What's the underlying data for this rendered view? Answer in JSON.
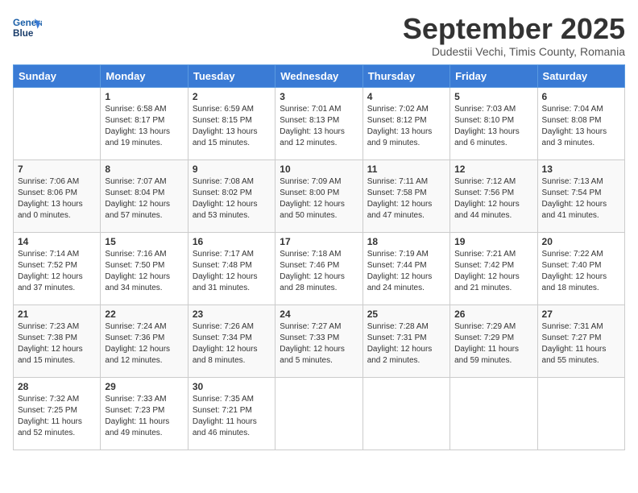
{
  "header": {
    "logo_line1": "General",
    "logo_line2": "Blue",
    "month_title": "September 2025",
    "subtitle": "Dudestii Vechi, Timis County, Romania"
  },
  "days_of_week": [
    "Sunday",
    "Monday",
    "Tuesday",
    "Wednesday",
    "Thursday",
    "Friday",
    "Saturday"
  ],
  "weeks": [
    [
      {
        "day": "",
        "content": ""
      },
      {
        "day": "1",
        "content": "Sunrise: 6:58 AM\nSunset: 8:17 PM\nDaylight: 13 hours\nand 19 minutes."
      },
      {
        "day": "2",
        "content": "Sunrise: 6:59 AM\nSunset: 8:15 PM\nDaylight: 13 hours\nand 15 minutes."
      },
      {
        "day": "3",
        "content": "Sunrise: 7:01 AM\nSunset: 8:13 PM\nDaylight: 13 hours\nand 12 minutes."
      },
      {
        "day": "4",
        "content": "Sunrise: 7:02 AM\nSunset: 8:12 PM\nDaylight: 13 hours\nand 9 minutes."
      },
      {
        "day": "5",
        "content": "Sunrise: 7:03 AM\nSunset: 8:10 PM\nDaylight: 13 hours\nand 6 minutes."
      },
      {
        "day": "6",
        "content": "Sunrise: 7:04 AM\nSunset: 8:08 PM\nDaylight: 13 hours\nand 3 minutes."
      }
    ],
    [
      {
        "day": "7",
        "content": "Sunrise: 7:06 AM\nSunset: 8:06 PM\nDaylight: 13 hours\nand 0 minutes."
      },
      {
        "day": "8",
        "content": "Sunrise: 7:07 AM\nSunset: 8:04 PM\nDaylight: 12 hours\nand 57 minutes."
      },
      {
        "day": "9",
        "content": "Sunrise: 7:08 AM\nSunset: 8:02 PM\nDaylight: 12 hours\nand 53 minutes."
      },
      {
        "day": "10",
        "content": "Sunrise: 7:09 AM\nSunset: 8:00 PM\nDaylight: 12 hours\nand 50 minutes."
      },
      {
        "day": "11",
        "content": "Sunrise: 7:11 AM\nSunset: 7:58 PM\nDaylight: 12 hours\nand 47 minutes."
      },
      {
        "day": "12",
        "content": "Sunrise: 7:12 AM\nSunset: 7:56 PM\nDaylight: 12 hours\nand 44 minutes."
      },
      {
        "day": "13",
        "content": "Sunrise: 7:13 AM\nSunset: 7:54 PM\nDaylight: 12 hours\nand 41 minutes."
      }
    ],
    [
      {
        "day": "14",
        "content": "Sunrise: 7:14 AM\nSunset: 7:52 PM\nDaylight: 12 hours\nand 37 minutes."
      },
      {
        "day": "15",
        "content": "Sunrise: 7:16 AM\nSunset: 7:50 PM\nDaylight: 12 hours\nand 34 minutes."
      },
      {
        "day": "16",
        "content": "Sunrise: 7:17 AM\nSunset: 7:48 PM\nDaylight: 12 hours\nand 31 minutes."
      },
      {
        "day": "17",
        "content": "Sunrise: 7:18 AM\nSunset: 7:46 PM\nDaylight: 12 hours\nand 28 minutes."
      },
      {
        "day": "18",
        "content": "Sunrise: 7:19 AM\nSunset: 7:44 PM\nDaylight: 12 hours\nand 24 minutes."
      },
      {
        "day": "19",
        "content": "Sunrise: 7:21 AM\nSunset: 7:42 PM\nDaylight: 12 hours\nand 21 minutes."
      },
      {
        "day": "20",
        "content": "Sunrise: 7:22 AM\nSunset: 7:40 PM\nDaylight: 12 hours\nand 18 minutes."
      }
    ],
    [
      {
        "day": "21",
        "content": "Sunrise: 7:23 AM\nSunset: 7:38 PM\nDaylight: 12 hours\nand 15 minutes."
      },
      {
        "day": "22",
        "content": "Sunrise: 7:24 AM\nSunset: 7:36 PM\nDaylight: 12 hours\nand 12 minutes."
      },
      {
        "day": "23",
        "content": "Sunrise: 7:26 AM\nSunset: 7:34 PM\nDaylight: 12 hours\nand 8 minutes."
      },
      {
        "day": "24",
        "content": "Sunrise: 7:27 AM\nSunset: 7:33 PM\nDaylight: 12 hours\nand 5 minutes."
      },
      {
        "day": "25",
        "content": "Sunrise: 7:28 AM\nSunset: 7:31 PM\nDaylight: 12 hours\nand 2 minutes."
      },
      {
        "day": "26",
        "content": "Sunrise: 7:29 AM\nSunset: 7:29 PM\nDaylight: 11 hours\nand 59 minutes."
      },
      {
        "day": "27",
        "content": "Sunrise: 7:31 AM\nSunset: 7:27 PM\nDaylight: 11 hours\nand 55 minutes."
      }
    ],
    [
      {
        "day": "28",
        "content": "Sunrise: 7:32 AM\nSunset: 7:25 PM\nDaylight: 11 hours\nand 52 minutes."
      },
      {
        "day": "29",
        "content": "Sunrise: 7:33 AM\nSunset: 7:23 PM\nDaylight: 11 hours\nand 49 minutes."
      },
      {
        "day": "30",
        "content": "Sunrise: 7:35 AM\nSunset: 7:21 PM\nDaylight: 11 hours\nand 46 minutes."
      },
      {
        "day": "",
        "content": ""
      },
      {
        "day": "",
        "content": ""
      },
      {
        "day": "",
        "content": ""
      },
      {
        "day": "",
        "content": ""
      }
    ]
  ]
}
